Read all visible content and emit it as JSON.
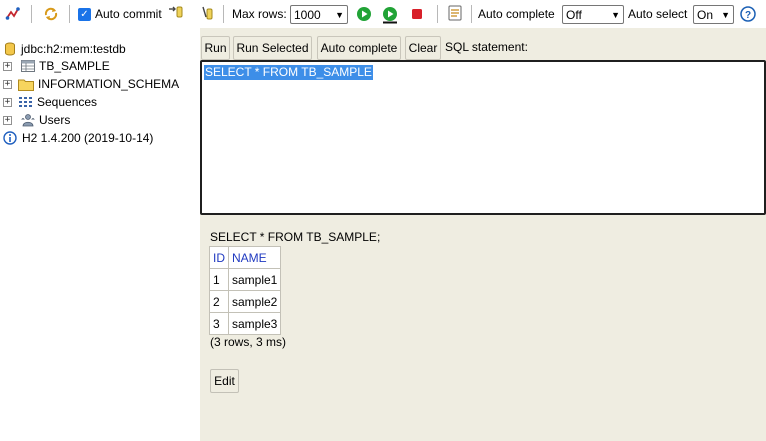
{
  "toolbar": {
    "auto_commit_label": "Auto commit",
    "auto_commit_checked": true,
    "max_rows_label": "Max rows:",
    "max_rows_value": "1000",
    "auto_complete_label": "Auto complete",
    "auto_complete_value": "Off",
    "auto_select_label": "Auto select",
    "auto_select_value": "On",
    "help_symbol": "?"
  },
  "tree": {
    "connection": "jdbc:h2:mem:testdb",
    "items": [
      {
        "label": "TB_SAMPLE",
        "icon": "table-icon"
      },
      {
        "label": "INFORMATION_SCHEMA",
        "icon": "folder-icon"
      },
      {
        "label": "Sequences",
        "icon": "sequences-icon"
      },
      {
        "label": "Users",
        "icon": "users-icon"
      }
    ],
    "version": "H2 1.4.200 (2019-10-14)"
  },
  "query": {
    "buttons": {
      "run": "Run",
      "run_selected": "Run Selected",
      "auto_complete": "Auto complete",
      "clear": "Clear"
    },
    "sql_label": "SQL statement:",
    "sql_text": "SELECT * FROM TB_SAMPLE"
  },
  "result": {
    "statement": "SELECT * FROM TB_SAMPLE;",
    "columns": [
      "ID",
      "NAME"
    ],
    "rows": [
      [
        "1",
        "sample1"
      ],
      [
        "2",
        "sample2"
      ],
      [
        "3",
        "sample3"
      ]
    ],
    "meta": "(3 rows, 3 ms)",
    "edit_label": "Edit"
  },
  "colors": {
    "pane_background": "#efede1",
    "selection": "#3d8ee8",
    "column_header": "#1f39c0",
    "run_green": "#21a336",
    "stop_red": "#d8202a",
    "help_blue": "#1a5fb4"
  }
}
